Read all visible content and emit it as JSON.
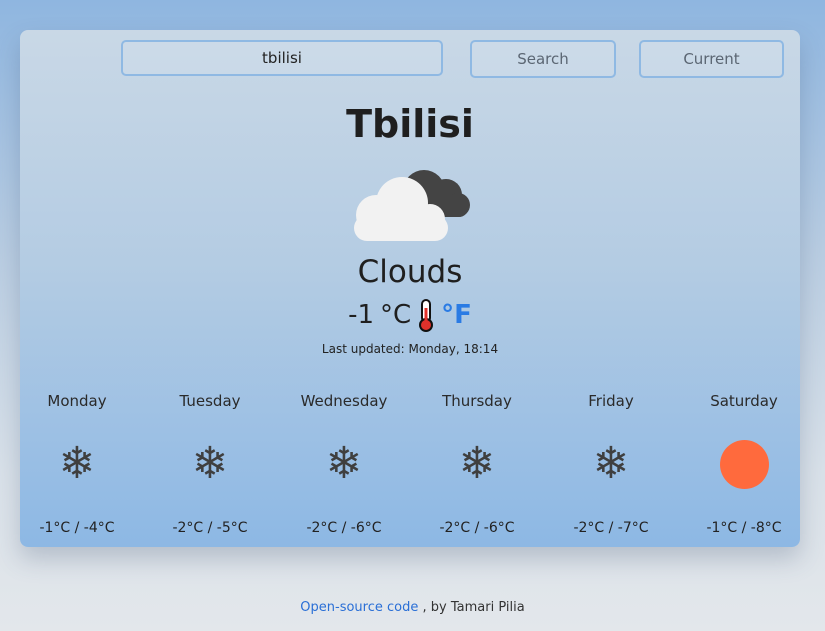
{
  "search": {
    "value": "tbilisi",
    "button_label": "Search",
    "current_label": "Current"
  },
  "weather": {
    "city": "Tbilisi",
    "description": "Clouds",
    "icon": "clouds-icon",
    "temperature": "-1",
    "unit_c": "°C",
    "unit_f": "°F",
    "last_updated": "Last updated: Monday, 18:14"
  },
  "forecast": [
    {
      "day": "Monday",
      "icon": "snowflake-icon",
      "temps": "-1°C / -4°C"
    },
    {
      "day": "Tuesday",
      "icon": "snowflake-icon",
      "temps": "-2°C / -5°C"
    },
    {
      "day": "Wednesday",
      "icon": "snowflake-icon",
      "temps": "-2°C / -6°C"
    },
    {
      "day": "Thursday",
      "icon": "snowflake-icon",
      "temps": "-2°C / -6°C"
    },
    {
      "day": "Friday",
      "icon": "snowflake-icon",
      "temps": "-2°C / -7°C"
    },
    {
      "day": "Saturday",
      "icon": "sun-icon",
      "temps": "-1°C / -8°C"
    }
  ],
  "footer": {
    "link_text": "Open-source code",
    "suffix": ", by Tamari Pilia"
  },
  "colors": {
    "accent": "#2a7be4",
    "sun": "#ff6a3d",
    "snow": "#3f3f3f"
  }
}
